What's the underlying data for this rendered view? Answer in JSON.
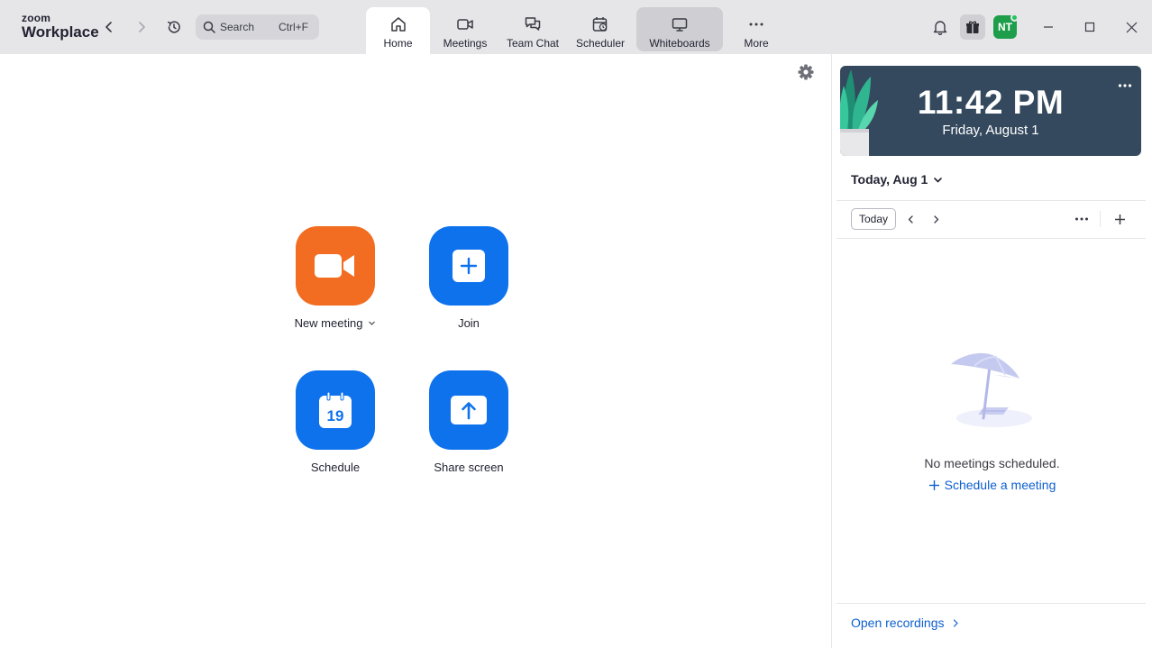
{
  "app": {
    "logo_line1": "zoom",
    "logo_line2": "Workplace"
  },
  "search": {
    "label": "Search",
    "shortcut": "Ctrl+F"
  },
  "tabs": [
    {
      "label": "Home",
      "icon": "home-icon",
      "active": true
    },
    {
      "label": "Meetings",
      "icon": "video-camera-icon"
    },
    {
      "label": "Team Chat",
      "icon": "chat-bubbles-icon"
    },
    {
      "label": "Scheduler",
      "icon": "calendar-clock-icon"
    },
    {
      "label": "Whiteboards",
      "icon": "whiteboard-icon",
      "hovered": true
    },
    {
      "label": "More",
      "icon": "more-dots-icon"
    }
  ],
  "user": {
    "initials": "NT",
    "status": "online"
  },
  "actions": [
    {
      "label": "New meeting",
      "icon": "video-camera-icon",
      "color": "#f26d21",
      "has_dropdown": true
    },
    {
      "label": "Join",
      "icon": "plus-icon",
      "color": "#0e72ed"
    },
    {
      "label": "Schedule",
      "icon": "calendar-icon",
      "calendar_day": "19",
      "color": "#0e72ed"
    },
    {
      "label": "Share screen",
      "icon": "upload-arrow-icon",
      "color": "#0e72ed"
    }
  ],
  "panel": {
    "clock_time": "11:42 PM",
    "clock_date": "Friday, August 1",
    "date_selector": "Today, Aug 1",
    "today_button": "Today",
    "empty_message": "No meetings scheduled.",
    "schedule_link": "Schedule a meeting",
    "open_recordings": "Open recordings"
  },
  "colors": {
    "topbar": "#e6e6e9",
    "accent_blue": "#0e72ed",
    "accent_orange": "#f26d21",
    "link": "#0e5fcf",
    "clock_bg": "#34495e"
  }
}
